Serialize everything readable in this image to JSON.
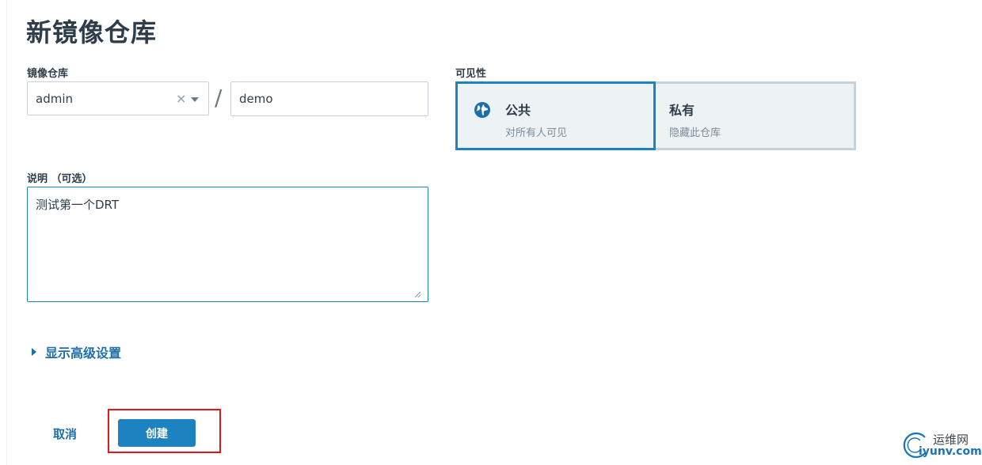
{
  "page": {
    "title": "新镜像仓库"
  },
  "repository": {
    "label": "镜像仓库",
    "namespace_value": "admin",
    "clear_glyph": "×",
    "separator": "/",
    "name_value": "demo"
  },
  "visibility": {
    "label": "可见性",
    "options": [
      {
        "title": "公共",
        "description": "对所有人可见",
        "selected": true
      },
      {
        "title": "私有",
        "description": "隐藏此仓库",
        "selected": false
      }
    ]
  },
  "description": {
    "label": "说明 （可选）",
    "value": "测试第一个DRT"
  },
  "advanced": {
    "label": "显示高级设置"
  },
  "actions": {
    "cancel_label": "取消",
    "create_label": "创建"
  },
  "watermark": {
    "cn": "运维网",
    "en": "iyunv.com"
  },
  "colors": {
    "accent": "#1d82c0",
    "link": "#1d6fa8",
    "highlight_outline": "#e0161b",
    "card_bg": "#edf2f5"
  },
  "icons": {
    "public": "globe-icon",
    "dropdown": "chevron-down-icon",
    "advanced": "caret-right-icon",
    "watermark": "watermark-logo-icon"
  }
}
